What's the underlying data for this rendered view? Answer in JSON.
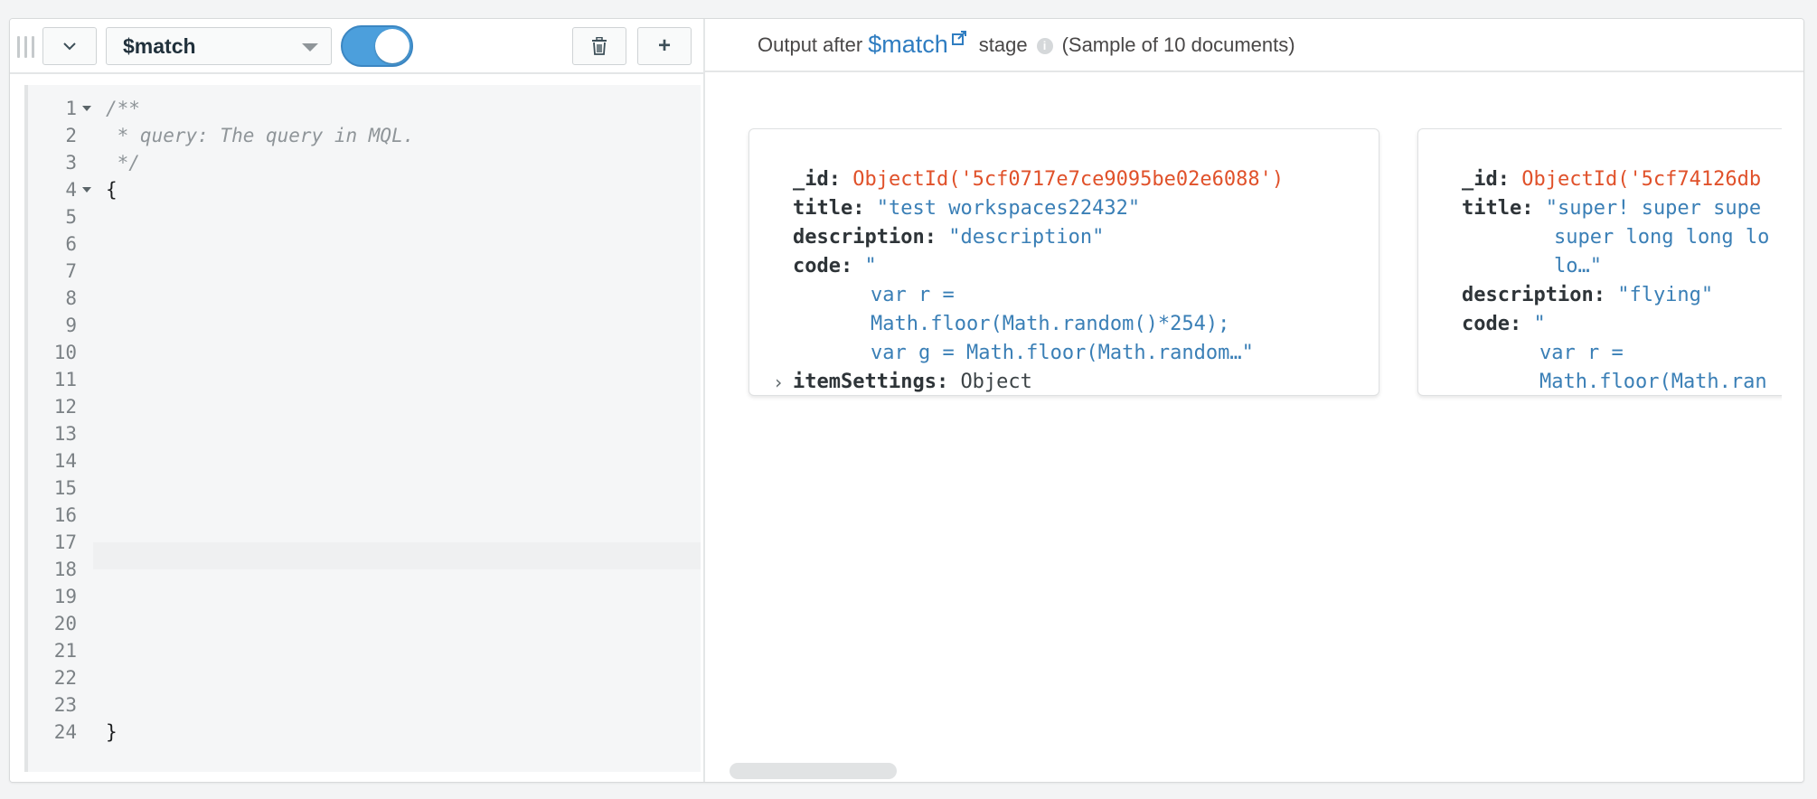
{
  "toolbar": {
    "stage_operator": "$match",
    "toggle_enabled": true,
    "add_label": "+"
  },
  "editor": {
    "lines": [
      {
        "n": "1",
        "text": "/**",
        "kind": "comment",
        "fold": true
      },
      {
        "n": "2",
        "text": " * query: The query in MQL.",
        "kind": "comment",
        "fold": false
      },
      {
        "n": "3",
        "text": " */",
        "kind": "comment",
        "fold": false
      },
      {
        "n": "4",
        "text": "{",
        "kind": "code",
        "fold": true
      },
      {
        "n": "5",
        "text": "",
        "kind": "code",
        "fold": false
      },
      {
        "n": "6",
        "text": "",
        "kind": "code",
        "fold": false
      },
      {
        "n": "7",
        "text": "",
        "kind": "code",
        "fold": false
      },
      {
        "n": "8",
        "text": "",
        "kind": "code",
        "fold": false
      },
      {
        "n": "9",
        "text": "",
        "kind": "code",
        "fold": false
      },
      {
        "n": "10",
        "text": "",
        "kind": "code",
        "fold": false
      },
      {
        "n": "11",
        "text": "",
        "kind": "code",
        "fold": false
      },
      {
        "n": "12",
        "text": "",
        "kind": "code",
        "fold": false
      },
      {
        "n": "13",
        "text": "",
        "kind": "code",
        "fold": false
      },
      {
        "n": "14",
        "text": "",
        "kind": "code",
        "fold": false
      },
      {
        "n": "15",
        "text": "",
        "kind": "code",
        "fold": false
      },
      {
        "n": "16",
        "text": "",
        "kind": "code",
        "fold": false
      },
      {
        "n": "17",
        "text": "",
        "kind": "code",
        "fold": false
      },
      {
        "n": "18",
        "text": "",
        "kind": "code",
        "fold": false
      },
      {
        "n": "19",
        "text": "",
        "kind": "code",
        "fold": false
      },
      {
        "n": "20",
        "text": "",
        "kind": "code",
        "fold": false
      },
      {
        "n": "21",
        "text": "",
        "kind": "code",
        "fold": false
      },
      {
        "n": "22",
        "text": "",
        "kind": "code",
        "fold": false
      },
      {
        "n": "23",
        "text": "",
        "kind": "code",
        "fold": false
      },
      {
        "n": "24",
        "text": "}",
        "kind": "code",
        "fold": false
      }
    ]
  },
  "output": {
    "lead": "Output after",
    "stage_link": "$match",
    "stage_word": "stage",
    "sample_text": "(Sample of 10 documents)"
  },
  "documents": [
    {
      "id_key": "_id:",
      "id_value": "ObjectId('5cf0717e7ce9095be02e6088')",
      "title_key": "title:",
      "title_lines": [
        "\"test workspaces22432\""
      ],
      "description_key": "description:",
      "description_value": "\"description\"",
      "code_key": "code:",
      "code_open": "\"",
      "code_lines": [
        "var r =",
        "Math.floor(Math.random()*254);",
        "var g = Math.floor(Math.random…\""
      ],
      "extra_key": "itemSettings:",
      "extra_value": "Object"
    },
    {
      "id_key": "_id:",
      "id_value": "ObjectId('5cf74126db",
      "title_key": "title:",
      "title_lines": [
        "\"super! super supe",
        "super long long lo",
        "lo…\""
      ],
      "description_key": "description:",
      "description_value": "\"flying\"",
      "code_key": "code:",
      "code_open": "\"",
      "code_lines": [
        "var r =",
        "Math.floor(Math.ran"
      ]
    }
  ],
  "colors": {
    "accent": "#4c9fdc",
    "link": "#2f7dc1",
    "objectid": "#e0512a",
    "string": "#3a7fb6"
  },
  "icons": {
    "grip": "drag-handle-icon",
    "collapse": "chevron-down-icon",
    "trash": "trash-icon",
    "external": "external-link-icon",
    "info": "info-icon",
    "expand": "chevron-right-icon"
  }
}
